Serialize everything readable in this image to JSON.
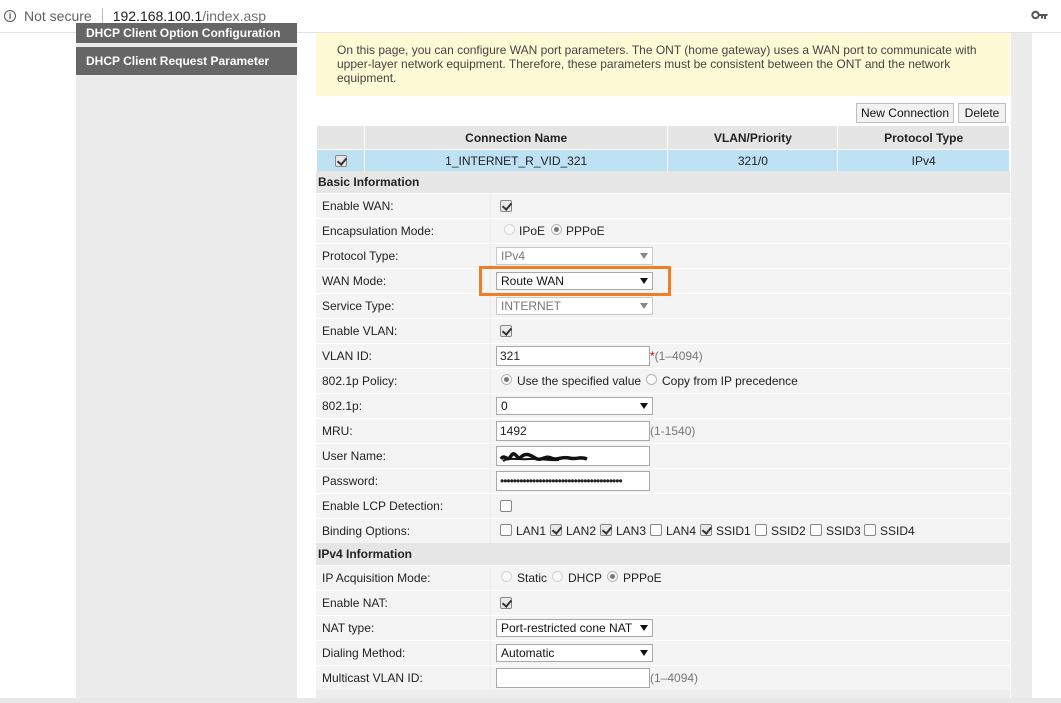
{
  "browser": {
    "security_label": "Not secure",
    "url_host": "192.168.100.1",
    "url_path": "/index.asp"
  },
  "sidebar": {
    "items": [
      {
        "label": "DHCP Client Option Configuration"
      },
      {
        "label": "DHCP Client Request Parameter"
      }
    ]
  },
  "note": "On this page, you can configure WAN port parameters. The ONT (home gateway) uses a WAN port to communicate with upper-layer network equipment. Therefore, these parameters must be consistent between the ONT and the network equipment.",
  "toolbar": {
    "new_label": "New Connection",
    "delete_label": "Delete"
  },
  "conn_table": {
    "headers": [
      "",
      "Connection Name",
      "VLAN/Priority",
      "Protocol Type"
    ],
    "rows": [
      {
        "selected": true,
        "name": "1_INTERNET_R_VID_321",
        "vlan": "321/0",
        "protocol": "IPv4"
      }
    ]
  },
  "basic": {
    "title": "Basic Information",
    "enable_wan": {
      "label": "Enable WAN:",
      "checked": true
    },
    "encap": {
      "label": "Encapsulation Mode:",
      "options": [
        "IPoE",
        "PPPoE"
      ],
      "selected": "PPPoE"
    },
    "protocol_type": {
      "label": "Protocol Type:",
      "value": "IPv4"
    },
    "wan_mode": {
      "label": "WAN Mode:",
      "value": "Route WAN"
    },
    "service_type": {
      "label": "Service Type:",
      "value": "INTERNET"
    },
    "enable_vlan": {
      "label": "Enable VLAN:",
      "checked": true
    },
    "vlan_id": {
      "label": "VLAN ID:",
      "value": "321",
      "required_mark": "*",
      "hint": "(1–4094)"
    },
    "policy": {
      "label": "802.1p Policy:",
      "options": [
        "Use the specified value",
        "Copy from IP precedence"
      ],
      "selected": "Use the specified value"
    },
    "p8021": {
      "label": "802.1p:",
      "value": "0"
    },
    "mru": {
      "label": "MRU:",
      "value": "1492",
      "hint": "(1-1540)"
    },
    "username": {
      "label": "User Name:"
    },
    "password": {
      "label": "Password:",
      "masked": "••••••••••••••••••••••••••••••••••••••"
    },
    "lcp": {
      "label": "Enable LCP Detection:",
      "checked": false
    },
    "binding": {
      "label": "Binding Options:",
      "options": [
        {
          "name": "LAN1",
          "checked": false
        },
        {
          "name": "LAN2",
          "checked": true
        },
        {
          "name": "LAN3",
          "checked": true
        },
        {
          "name": "LAN4",
          "checked": false
        },
        {
          "name": "SSID1",
          "checked": true
        },
        {
          "name": "SSID2",
          "checked": false
        },
        {
          "name": "SSID3",
          "checked": false
        },
        {
          "name": "SSID4",
          "checked": false
        }
      ]
    }
  },
  "ipv4": {
    "title": "IPv4 Information",
    "acq_mode": {
      "label": "IP Acquisition Mode:",
      "options": [
        "Static",
        "DHCP",
        "PPPoE"
      ],
      "selected": "PPPoE"
    },
    "enable_nat": {
      "label": "Enable NAT:",
      "checked": true
    },
    "nat_type": {
      "label": "NAT type:",
      "value": "Port-restricted cone NAT"
    },
    "dialing": {
      "label": "Dialing Method:",
      "value": "Automatic"
    },
    "multicast_vlan": {
      "label": "Multicast VLAN ID:",
      "value": "",
      "hint": "(1–4094)"
    }
  },
  "colors": {
    "highlight": "#f07e26",
    "selected_row": "#bee1f3",
    "note_bg": "#fdfbd5",
    "menu_bg": "#666666"
  }
}
